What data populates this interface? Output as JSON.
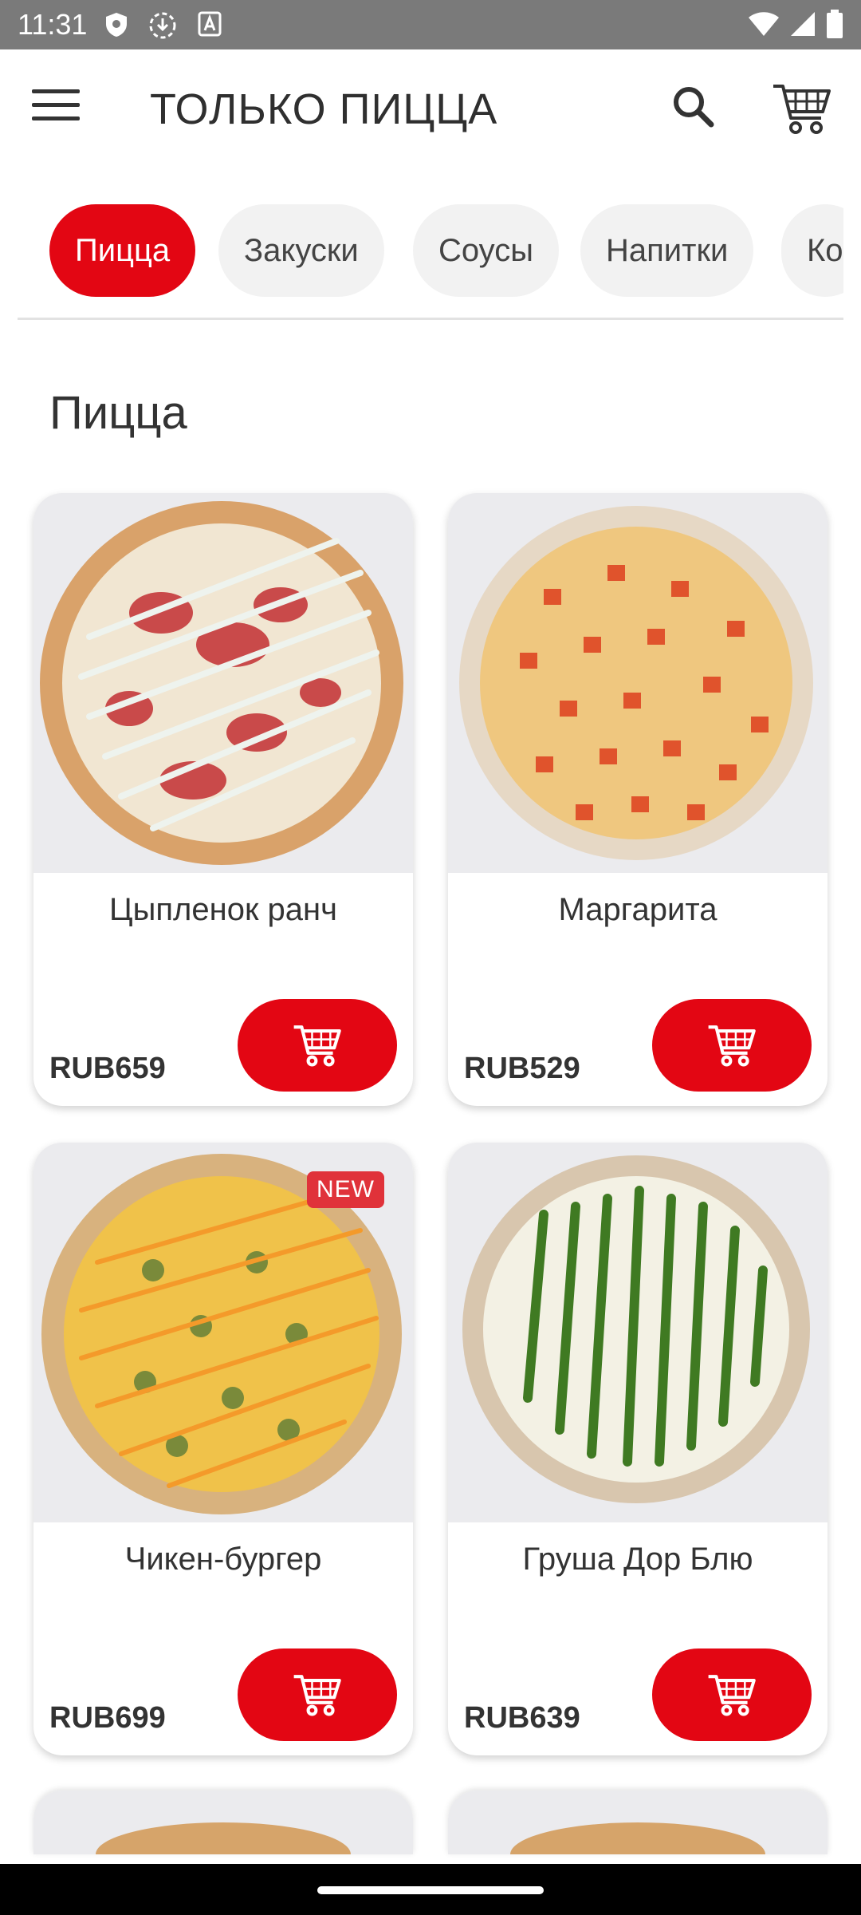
{
  "status_bar": {
    "time": "11:31"
  },
  "app": {
    "title": "ТОЛЬКО ПИЦЦА"
  },
  "categories": [
    {
      "label": "Пицца",
      "active": true
    },
    {
      "label": "Закуски",
      "active": false
    },
    {
      "label": "Соусы",
      "active": false
    },
    {
      "label": "Напитки",
      "active": false
    },
    {
      "label": "Ко",
      "active": false
    }
  ],
  "section": {
    "title": "Пицца"
  },
  "products": [
    {
      "name": "Цыпленок ранч",
      "price": "RUB659",
      "badge": ""
    },
    {
      "name": "Маргарита",
      "price": "RUB529",
      "badge": ""
    },
    {
      "name": "Чикен-бургер",
      "price": "RUB699",
      "badge": "NEW"
    },
    {
      "name": "Груша Дор Блю",
      "price": "RUB639",
      "badge": ""
    }
  ],
  "colors": {
    "accent": "#e30613",
    "chip_bg": "#f2f2f2",
    "statusbar": "#7a7a7a"
  }
}
